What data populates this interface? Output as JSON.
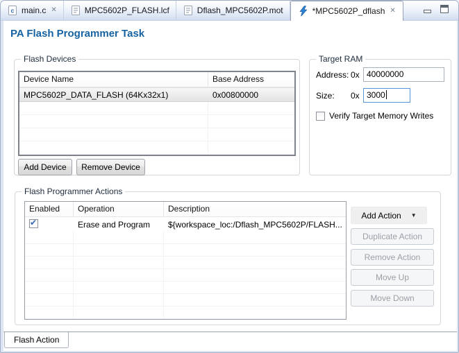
{
  "editor_tabs": [
    {
      "label": "main.c",
      "icon": "c-file-icon",
      "closable": true,
      "active": false
    },
    {
      "label": "MPC5602P_FLASH.lcf",
      "icon": "text-file-icon",
      "closable": false,
      "active": false
    },
    {
      "label": "Dflash_MPC5602P.mot",
      "icon": "text-file-icon",
      "closable": false,
      "active": false
    },
    {
      "label": "*MPC5602P_dflash",
      "icon": "flash-bolt-icon",
      "closable": true,
      "active": true
    }
  ],
  "page_title": "PA Flash Programmer Task",
  "flash_devices": {
    "group_label": "Flash Devices",
    "columns": [
      "Device Name",
      "Base Address"
    ],
    "rows": [
      {
        "device_name": "MPC5602P_DATA_FLASH (64Kx32x1)",
        "base_address": "0x00800000",
        "selected": true
      }
    ],
    "buttons": {
      "add": "Add Device",
      "remove": "Remove Device"
    }
  },
  "target_ram": {
    "group_label": "Target RAM",
    "address_label": "Address:",
    "address_prefix": "0x",
    "address_value": "40000000",
    "size_label": "Size:",
    "size_prefix": "0x",
    "size_value": "3000",
    "size_focused": true,
    "verify_label": "Verify Target Memory Writes",
    "verify_checked": false
  },
  "flash_actions": {
    "group_label": "Flash Programmer Actions",
    "columns": [
      "Enabled",
      "Operation",
      "Description"
    ],
    "rows": [
      {
        "enabled": true,
        "operation": "Erase and Program",
        "description": "${workspace_loc:/Dflash_MPC5602P/FLASH..."
      }
    ],
    "buttons": {
      "add": "Add Action",
      "duplicate": "Duplicate Action",
      "remove": "Remove Action",
      "move_up": "Move Up",
      "move_down": "Move Down"
    },
    "disabled_buttons": [
      "Duplicate Action",
      "Remove Action",
      "Move Up",
      "Move Down"
    ]
  },
  "bottom_tabs": [
    {
      "label": "Flash Action",
      "active": true
    }
  ],
  "icons": {
    "close": "✕",
    "check": "✔",
    "dropdown_arrow": "▼"
  },
  "colors": {
    "title_text": "#1563A2",
    "focused_input_border": "#5694D8",
    "checkbox_check": "#3568B8",
    "tabbar_gradient_bottom": "#D0DCEF"
  }
}
